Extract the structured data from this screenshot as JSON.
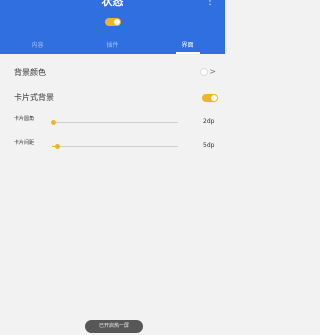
{
  "header": {
    "title": "状态",
    "more_icon": "more-vert-icon",
    "master_toggle": true,
    "accent": "#2f6fe0"
  },
  "tabs": [
    {
      "label": "内容"
    },
    {
      "label": "插件"
    },
    {
      "label": "界面"
    }
  ],
  "settings": {
    "background_color": {
      "label": "背景颜色"
    },
    "card_background": {
      "label": "卡片式背景",
      "enabled": true
    },
    "card_radius": {
      "label": "卡片圆角",
      "value": "2dp",
      "level": 0.0
    },
    "card_spacing": {
      "label": "卡片间距",
      "value": "5dp",
      "level": 0.04
    }
  },
  "toast": {
    "text": "已开启热一屏"
  },
  "colors": {
    "toggle_on": "#f0b429",
    "background": "#f2f2f2"
  }
}
